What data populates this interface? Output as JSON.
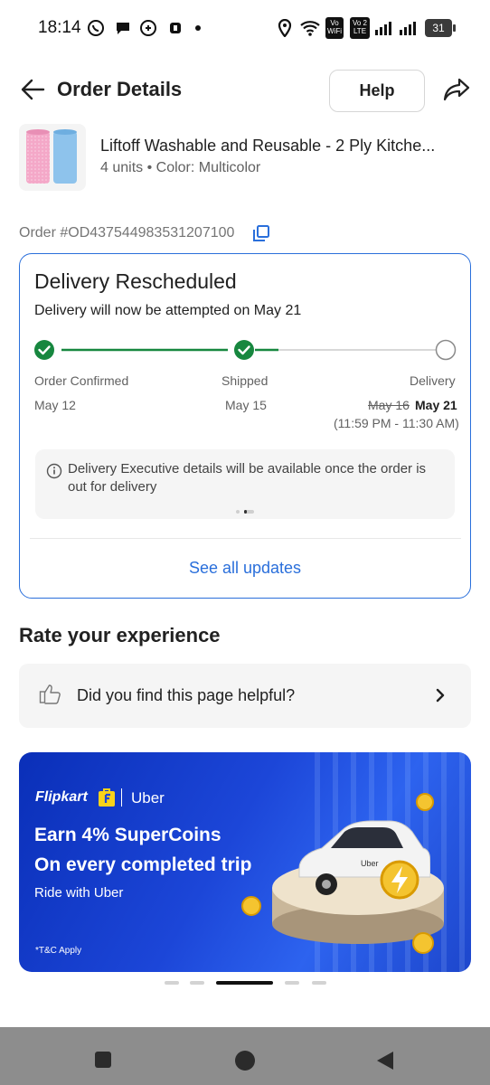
{
  "status_bar": {
    "time": "18:14",
    "chip1": "Vo\nWiFi",
    "chip2": "Vo 2\nLTE",
    "battery": "31"
  },
  "header": {
    "title": "Order Details",
    "help_label": "Help"
  },
  "product": {
    "name": "Liftoff Washable and Reusable - 2 Ply Kitche...",
    "meta": "4 units • Color: Multicolor"
  },
  "order": {
    "id": "Order #OD437544983531207100"
  },
  "delivery": {
    "title": "Delivery Rescheduled",
    "subtitle": "Delivery will now be attempted on May 21",
    "steps": [
      {
        "label": "Order Confirmed",
        "date": "May 12",
        "done": true
      },
      {
        "label": "Shipped",
        "date": "May 15",
        "done": true
      },
      {
        "label": "Delivery",
        "old_date": "May 16",
        "date": "May 21",
        "window": "(11:59 PM - 11:30 AM)",
        "done": false
      }
    ],
    "info": "Delivery Executive details will be available once the order is out for delivery",
    "see_all": "See all updates"
  },
  "rate": {
    "title": "Rate your experience",
    "question": "Did you find this page helpful?"
  },
  "banner": {
    "brand": "Flipkart",
    "partner": "Uber",
    "headline1": "Earn 4% SuperCoins",
    "headline2": "On every completed trip",
    "sub": "Ride with Uber",
    "tc": "*T&C Apply",
    "car_text": "Uber"
  },
  "carousel": {
    "count": 6,
    "active": 2
  },
  "colors": {
    "accent_blue": "#2a6fdb",
    "success_green": "#17873f",
    "banner_blue": "#1c46d8"
  }
}
